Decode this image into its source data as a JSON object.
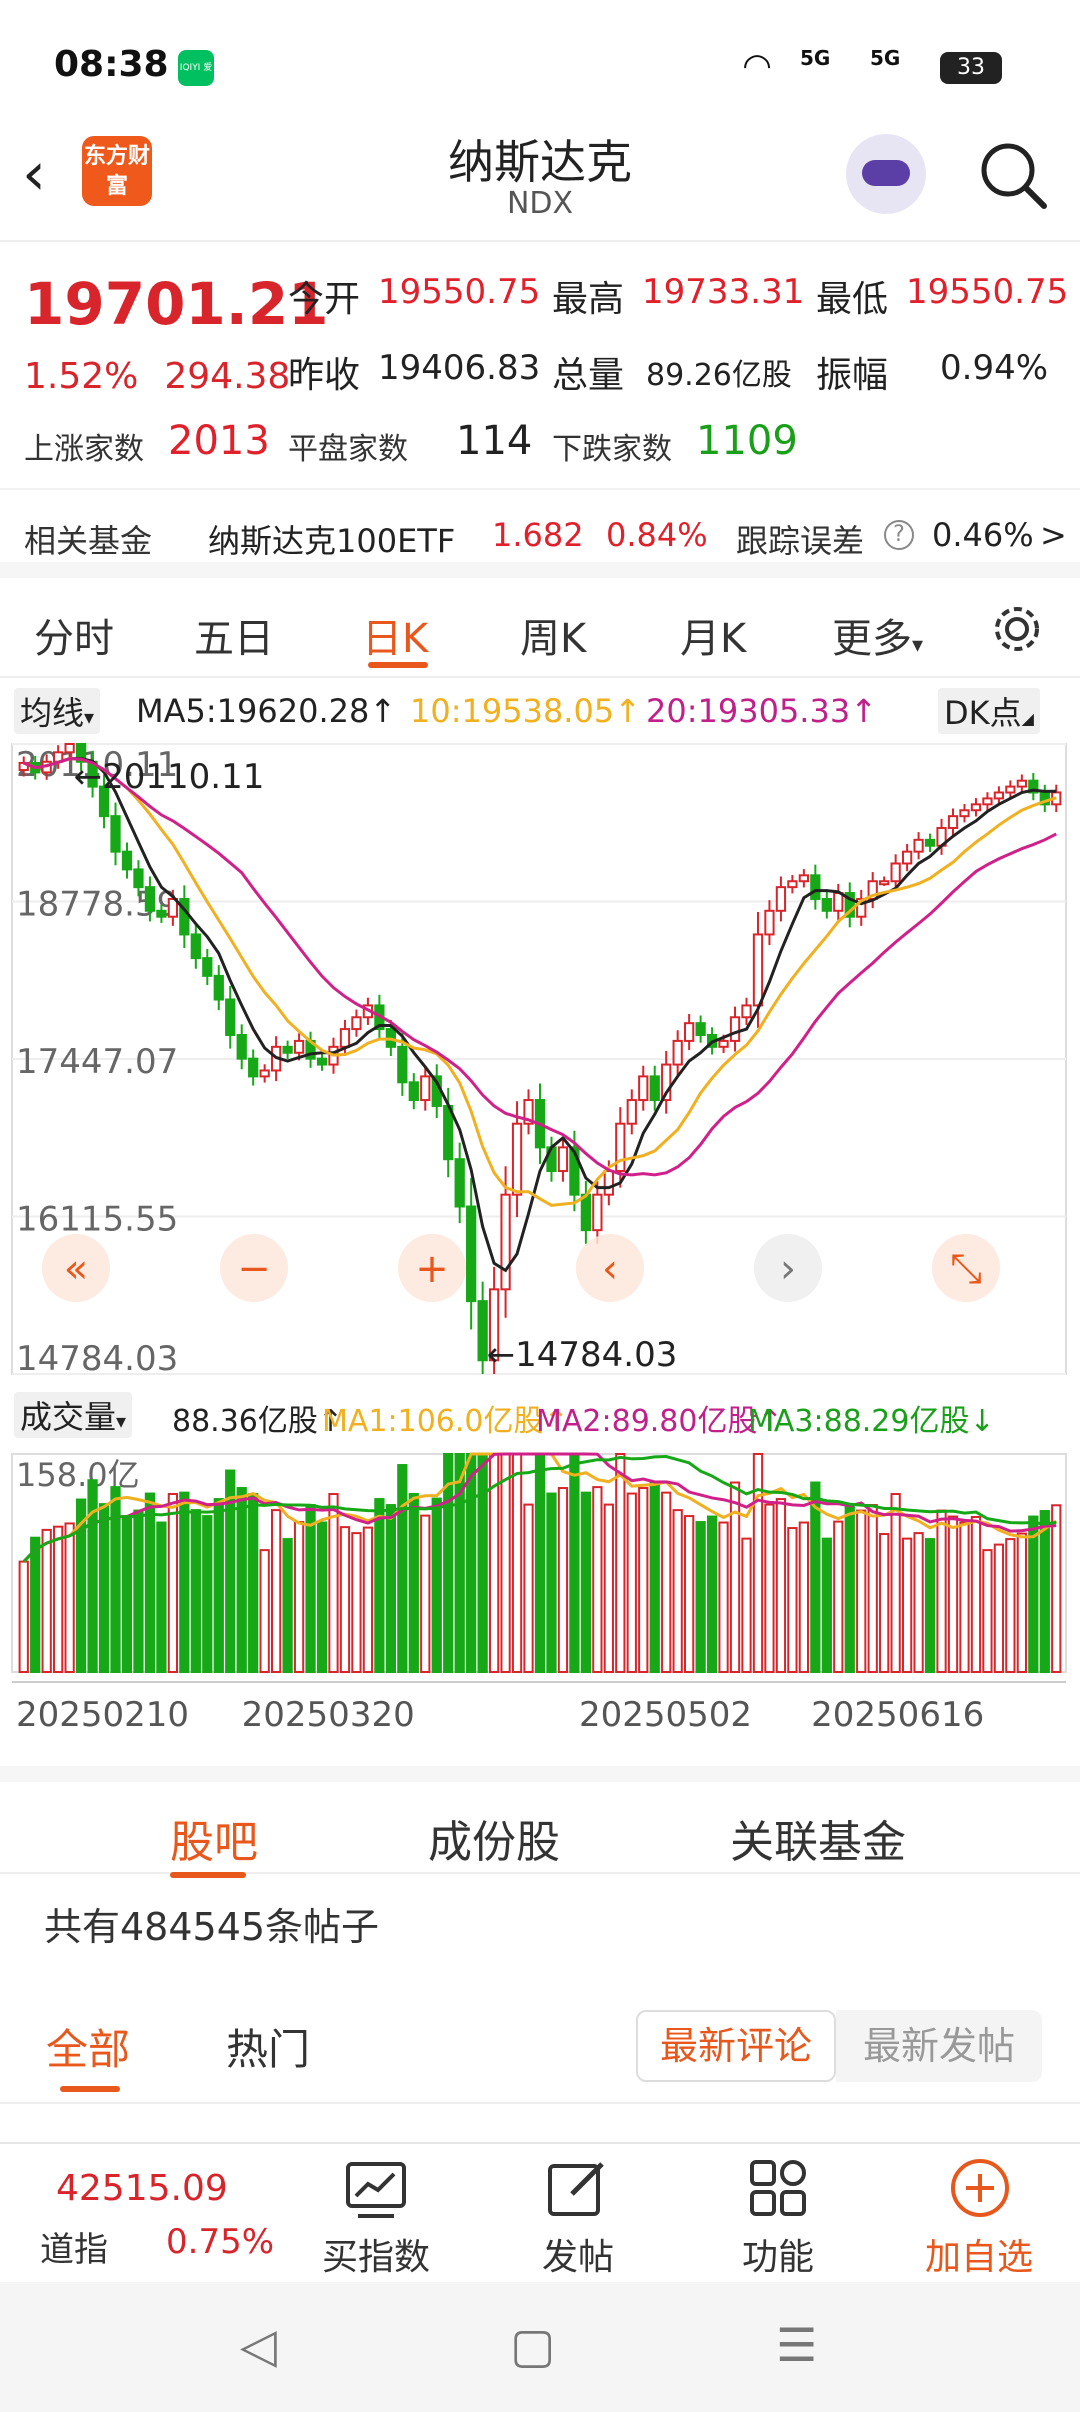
{
  "status": {
    "time": "08:38",
    "app_badge": "IQIYI 爱奇艺",
    "signal1": "5G",
    "signal2": "5G",
    "battery": "33"
  },
  "header": {
    "title": "纳斯达克",
    "code": "NDX",
    "logo": "东方财富"
  },
  "quote": {
    "price": "19701.21",
    "change_pct": "1.52%",
    "change": "294.38",
    "open_label": "今开",
    "open": "19550.75",
    "high_label": "最高",
    "high": "19733.31",
    "low_label": "最低",
    "low": "19550.75",
    "prev_label": "昨收",
    "prev": "19406.83",
    "vol_label": "总量",
    "vol": "89.26亿股",
    "amp_label": "振幅",
    "amp": "0.94%",
    "up_label": "上涨家数",
    "up": "2013",
    "flat_label": "平盘家数",
    "flat": "114",
    "down_label": "下跌家数",
    "down": "1109"
  },
  "fund": {
    "label": "相关基金",
    "name": "纳斯达克100ETF",
    "price": "1.682",
    "pct": "0.84%",
    "err_label": "跟踪误差",
    "err_help": "?",
    "err": "0.46%",
    "arrow": ">"
  },
  "tabs": [
    "分时",
    "五日",
    "日K",
    "周K",
    "月K",
    "更多"
  ],
  "ma": {
    "dropdown": "均线",
    "ma5": "MA5:19620.28↑",
    "ma10": "10:19538.05↑",
    "ma20": "20:19305.33↑",
    "dk": "DK点"
  },
  "chart_data": {
    "type": "candlestick",
    "y_ticks": [
      "20110.11",
      "18778.59",
      "17447.07",
      "16115.55",
      "14784.03"
    ],
    "max_label": "←20110.11",
    "min_label": "←14784.03",
    "x_ticks": [
      "20250210",
      "20250320",
      "20250502",
      "20250616"
    ],
    "colors": {
      "up": "#d8242b",
      "down": "#16a816",
      "ma5": "#222222",
      "ma10": "#f0b020",
      "ma20": "#d0208a"
    },
    "closes": [
      19950,
      19870,
      19960,
      20040,
      20110,
      19960,
      19750,
      19500,
      19200,
      19050,
      18900,
      18700,
      18650,
      18800,
      18500,
      18300,
      18150,
      17950,
      17650,
      17450,
      17300,
      17350,
      17550,
      17500,
      17600,
      17450,
      17400,
      17550,
      17700,
      17800,
      17900,
      17700,
      17550,
      17250,
      17100,
      17300,
      17050,
      16600,
      16200,
      15400,
      14900,
      15500,
      16300,
      16900,
      17100,
      16700,
      16500,
      16700,
      16300,
      16000,
      16300,
      16500,
      16900,
      17100,
      17300,
      17100,
      17400,
      17600,
      17750,
      17650,
      17550,
      17600,
      17800,
      17900,
      18500,
      18700,
      18900,
      18950,
      19000,
      18800,
      18700,
      18850,
      18650,
      18800,
      18950,
      18950,
      19100,
      19200,
      19300,
      19250,
      19400,
      19500,
      19550,
      19600,
      19650,
      19700,
      19750,
      19800,
      19700,
      19600,
      19701
    ]
  },
  "volume": {
    "dropdown": "成交量",
    "vol": "88.36亿股↑",
    "ma1": "MA1:106.0亿股↑",
    "ma2": "MA2:89.80亿股↑",
    "ma3": "MA3:88.29亿股↓",
    "max": "158.0亿"
  },
  "chart_controls": [
    "«",
    "−",
    "+",
    "‹",
    "›",
    "⤡"
  ],
  "subtabs": [
    "股吧",
    "成份股",
    "关联基金"
  ],
  "posts": {
    "count": "共有484545条帖子"
  },
  "filter": {
    "all": "全部",
    "hot": "热门",
    "latest_comment": "最新评论",
    "latest_post": "最新发帖"
  },
  "bottom": {
    "index_value": "42515.09",
    "index_name": "道指",
    "index_pct": "0.75%",
    "buy": "买指数",
    "post": "发帖",
    "func": "功能",
    "add": "加自选"
  },
  "nav": {
    "back": "◁",
    "home": "▢",
    "menu": "☰"
  }
}
